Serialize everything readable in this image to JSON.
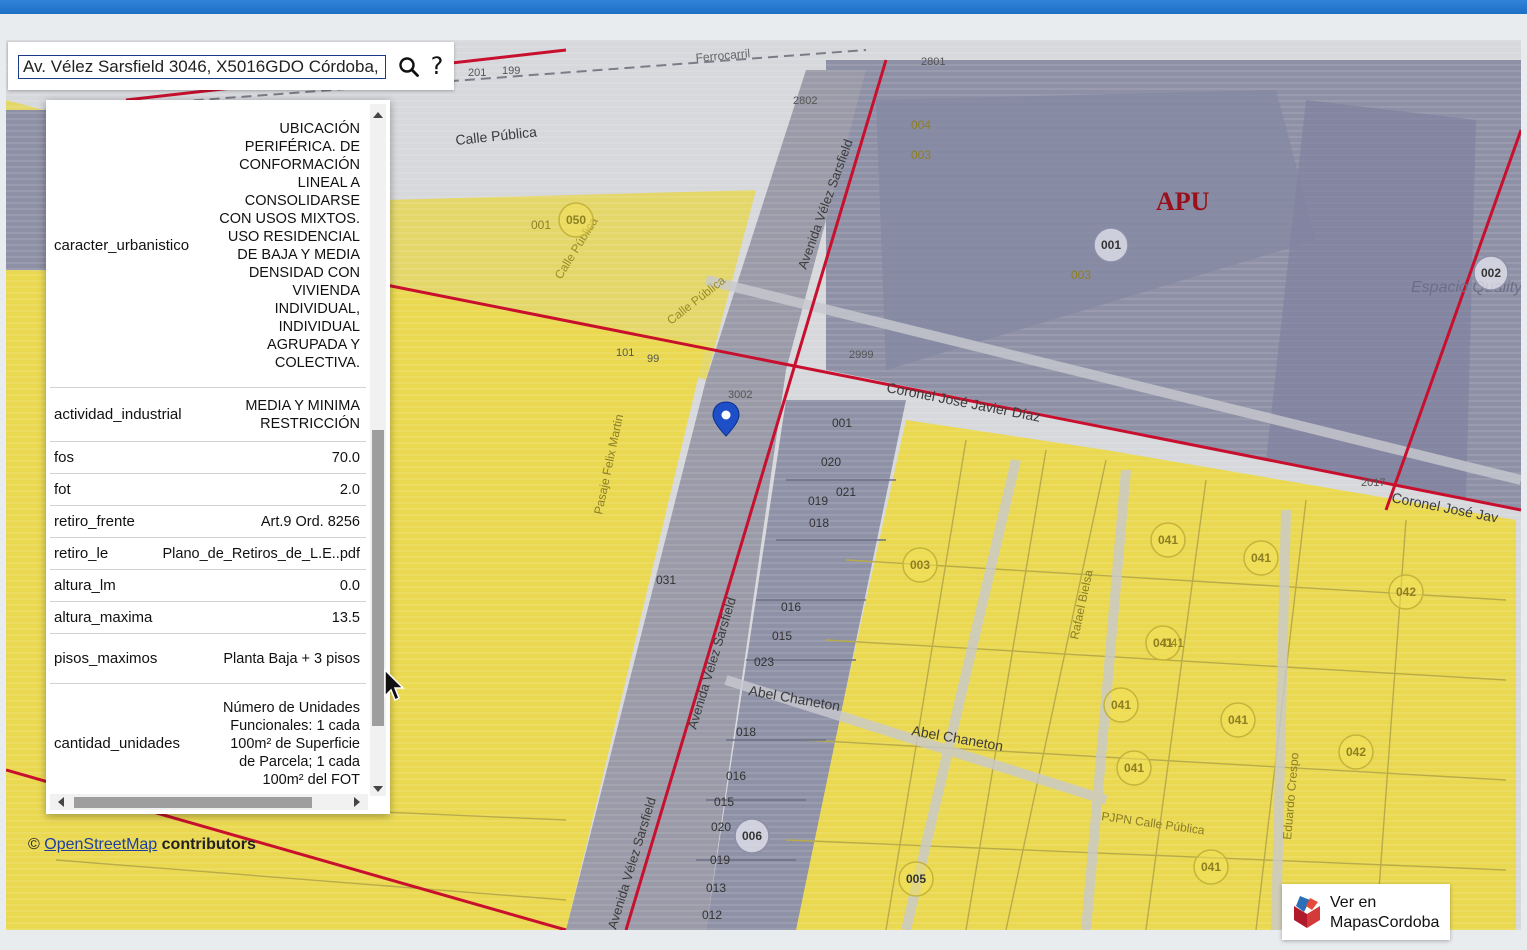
{
  "search": {
    "value": "Av. Vélez Sarsfield 3046, X5016GDO Córdoba,",
    "help_label": "?"
  },
  "info_panel": {
    "rows": [
      {
        "key": "caracter_urbanistico",
        "value": "UBICACIÓN PERIFÉRICA. DE CONFORMACIÓN LINEAL A CONSOLIDARSE CON USOS MIXTOS. USO RESIDENCIAL DE BAJA Y MEDIA DENSIDAD CON VIVIENDA INDIVIDUAL, INDIVIDUAL AGRUPADA Y COLECTIVA."
      },
      {
        "key": "actividad_industrial",
        "value": "MEDIA Y MINIMA RESTRICCIÓN"
      },
      {
        "key": "fos",
        "value": "70.0"
      },
      {
        "key": "fot",
        "value": "2.0"
      },
      {
        "key": "retiro_frente",
        "value": "Art.9 Ord. 8256"
      },
      {
        "key": "retiro_le",
        "value": "Plano_de_Retiros_de_L.E..pdf"
      },
      {
        "key": "altura_lm",
        "value": "0.0"
      },
      {
        "key": "altura_maxima",
        "value": "13.5"
      },
      {
        "key": "pisos_maximos",
        "value": "Planta Baja + 3 pisos"
      },
      {
        "key": "cantidad_unidades",
        "value": "Número de Unidades Funcionales: 1 cada 100m² de Superficie de Parcela; 1 cada 100m² del FOT"
      }
    ]
  },
  "map": {
    "zone_label": "APU",
    "streets": {
      "calle_publica_1": "Calle Pública",
      "calle_publica_2": "Calle Pública",
      "calle_publica_3": "Calle Pública",
      "avenida_velez_1": "Avenida Vélez Sarsfield",
      "avenida_velez_2": "Avenida Vélez Sarsfield",
      "avenida_velez_3": "Avenida Vélez Sarsfield",
      "coronel_1": "Coronel José Javier Díaz",
      "coronel_2": "Coronel José Jav",
      "abel_1": "Abel Chaneton",
      "abel_2": "Abel Chaneton",
      "pasaje": "Pasaje Felix Martin",
      "rafael": "Rafael Bielsa",
      "eduardo": "Eduardo Crespo",
      "ferrocarril": "Ferrocarril",
      "pjpn": "PJPN Calle Pública",
      "espacio": "Espacio Quality"
    },
    "parcels": [
      "001",
      "003",
      "004",
      "003",
      "050",
      "001",
      "002",
      "003",
      "041",
      "041",
      "042",
      "041",
      "041",
      "041",
      "041",
      "041",
      "042",
      "041",
      "006",
      "005",
      "016",
      "015",
      "023",
      "018",
      "016",
      "015",
      "020",
      "019",
      "013",
      "012",
      "020",
      "019",
      "018",
      "021",
      "001",
      "031"
    ],
    "red_parcels": [
      "001",
      "002"
    ],
    "house_numbers": [
      "3002",
      "2999",
      "2801",
      "2802",
      "199",
      "201",
      "101",
      "99",
      "2017"
    ]
  },
  "attribution": {
    "prefix": "©",
    "link": "OpenStreetMap",
    "suffix": "contributors"
  },
  "mapas_badge": {
    "line1": "Ver en",
    "line2": "MapasCordoba"
  },
  "colors": {
    "zone_yellow": "#efd94a",
    "zone_gray": "#8f91a8",
    "boundary_red": "#c8102e"
  }
}
